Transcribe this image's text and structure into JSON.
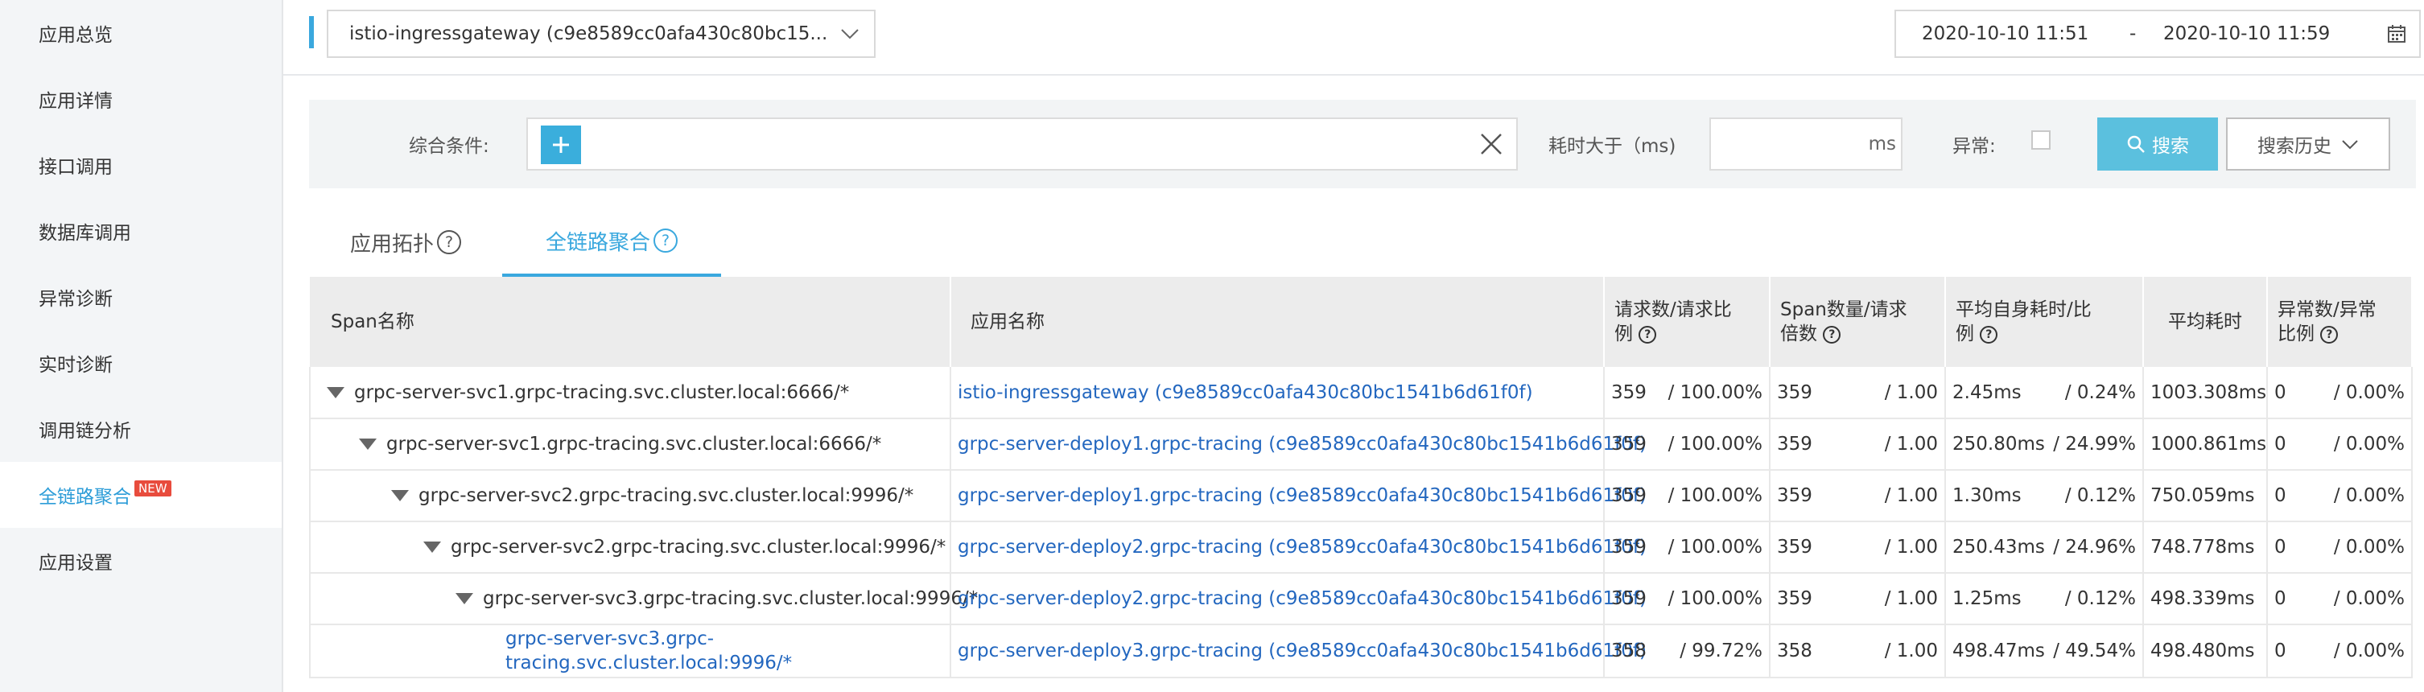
{
  "sidebar": {
    "items": [
      {
        "label": "应用总览"
      },
      {
        "label": "应用详情"
      },
      {
        "label": "接口调用"
      },
      {
        "label": "数据库调用"
      },
      {
        "label": "异常诊断"
      },
      {
        "label": "实时诊断"
      },
      {
        "label": "调用链分析"
      },
      {
        "label": "全链路聚合",
        "badge": "NEW",
        "active": true
      },
      {
        "label": "应用设置"
      }
    ]
  },
  "topbar": {
    "app_select_value": "istio-ingressgateway (c9e8589cc0afa430c80bc15...",
    "date_start": "2020-10-10 11:51",
    "date_sep": "-",
    "date_end": "2020-10-10 11:59"
  },
  "filter": {
    "condition_label": "综合条件:",
    "duration_label": "耗时大于（ms)",
    "duration_unit": "ms",
    "exception_label": "异常:",
    "search_label": "搜索",
    "history_label": "搜索历史"
  },
  "tabs": [
    {
      "label": "应用拓扑",
      "active": false
    },
    {
      "label": "全链路聚合",
      "active": true
    }
  ],
  "table": {
    "headers": {
      "span": "Span名称",
      "app": "应用名称",
      "req_line1": "请求数/请求比",
      "req_line2": "例",
      "spancount_line1": "Span数量/请求",
      "spancount_line2": "倍数",
      "selftime_line1": "平均自身耗时/比",
      "selftime_line2": "例",
      "avg": "平均耗时",
      "err_line1": "异常数/异常",
      "err_line2": "比例"
    },
    "rows": [
      {
        "span": "grpc-server-svc1.grpc-tracing.svc.cluster.local:6666/*",
        "app": "istio-ingressgateway (c9e8589cc0afa430c80bc1541b6d61f0f)",
        "req": "359",
        "req_pct": "/ 100.00%",
        "span_cnt": "359",
        "span_mult": "/ 1.00",
        "self": "2.45ms",
        "self_pct": "/ 0.24%",
        "avg": "1003.308ms",
        "err": "0",
        "err_pct": "/ 0.00%"
      },
      {
        "span": "grpc-server-svc1.grpc-tracing.svc.cluster.local:6666/*",
        "app": "grpc-server-deploy1.grpc-tracing (c9e8589cc0afa430c80bc1541b6d61f0f)",
        "req": "359",
        "req_pct": "/ 100.00%",
        "span_cnt": "359",
        "span_mult": "/ 1.00",
        "self": "250.80ms",
        "self_pct": "/ 24.99%",
        "avg": "1000.861ms",
        "err": "0",
        "err_pct": "/ 0.00%"
      },
      {
        "span": "grpc-server-svc2.grpc-tracing.svc.cluster.local:9996/*",
        "app": "grpc-server-deploy1.grpc-tracing (c9e8589cc0afa430c80bc1541b6d61f0f)",
        "req": "359",
        "req_pct": "/ 100.00%",
        "span_cnt": "359",
        "span_mult": "/ 1.00",
        "self": "1.30ms",
        "self_pct": "/ 0.12%",
        "avg": "750.059ms",
        "err": "0",
        "err_pct": "/ 0.00%"
      },
      {
        "span": "grpc-server-svc2.grpc-tracing.svc.cluster.local:9996/*",
        "app": "grpc-server-deploy2.grpc-tracing (c9e8589cc0afa430c80bc1541b6d61f0f)",
        "req": "359",
        "req_pct": "/ 100.00%",
        "span_cnt": "359",
        "span_mult": "/ 1.00",
        "self": "250.43ms",
        "self_pct": "/ 24.96%",
        "avg": "748.778ms",
        "err": "0",
        "err_pct": "/ 0.00%"
      },
      {
        "span": "grpc-server-svc3.grpc-tracing.svc.cluster.local:9996/*",
        "app": "grpc-server-deploy2.grpc-tracing (c9e8589cc0afa430c80bc1541b6d61f0f)",
        "req": "359",
        "req_pct": "/ 100.00%",
        "span_cnt": "359",
        "span_mult": "/ 1.00",
        "self": "1.25ms",
        "self_pct": "/ 0.12%",
        "avg": "498.339ms",
        "err": "0",
        "err_pct": "/ 0.00%"
      },
      {
        "span_line1": "grpc-server-svc3.grpc-",
        "span_line2": "tracing.svc.cluster.local:9996/*",
        "app": "grpc-server-deploy3.grpc-tracing (c9e8589cc0afa430c80bc1541b6d61f0f)",
        "req": "358",
        "req_pct": "/ 99.72%",
        "span_cnt": "358",
        "span_mult": "/ 1.00",
        "self": "498.47ms",
        "self_pct": "/ 49.54%",
        "avg": "498.480ms",
        "err": "0",
        "err_pct": "/ 0.00%"
      }
    ]
  }
}
